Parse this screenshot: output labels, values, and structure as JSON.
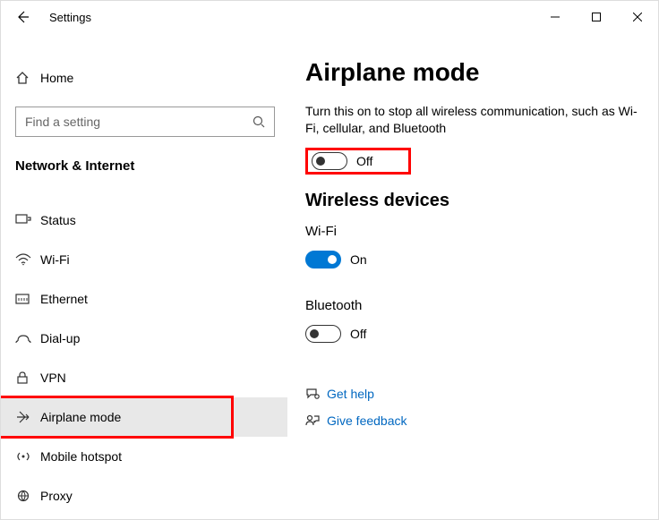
{
  "window": {
    "title": "Settings"
  },
  "sidebar": {
    "home_label": "Home",
    "search_placeholder": "Find a setting",
    "category_title": "Network & Internet",
    "items": [
      {
        "label": "Status"
      },
      {
        "label": "Wi-Fi"
      },
      {
        "label": "Ethernet"
      },
      {
        "label": "Dial-up"
      },
      {
        "label": "VPN"
      },
      {
        "label": "Airplane mode"
      },
      {
        "label": "Mobile hotspot"
      },
      {
        "label": "Proxy"
      }
    ]
  },
  "main": {
    "title": "Airplane mode",
    "description": "Turn this on to stop all wireless communication, such as Wi-Fi, cellular, and Bluetooth",
    "airplane_toggle_state": "Off",
    "wireless_devices_heading": "Wireless devices",
    "wifi_label": "Wi-Fi",
    "wifi_toggle_state": "On",
    "bluetooth_label": "Bluetooth",
    "bluetooth_toggle_state": "Off",
    "get_help_label": "Get help",
    "give_feedback_label": "Give feedback"
  }
}
